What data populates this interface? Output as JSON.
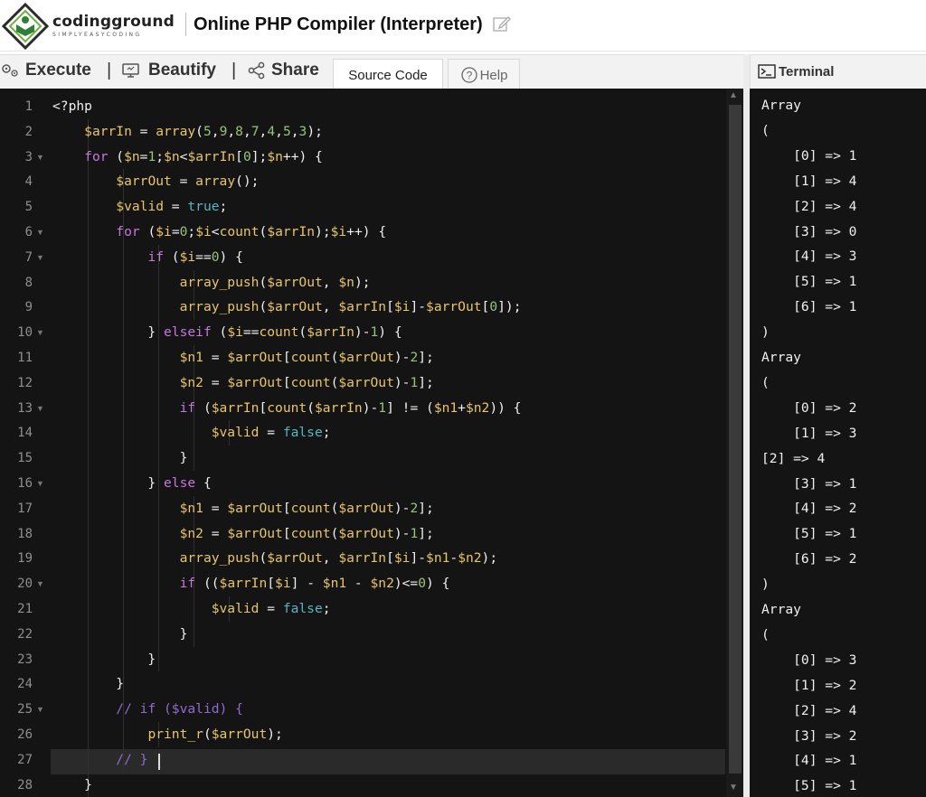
{
  "header": {
    "brand": "codingground",
    "tagline": "SIMPLYEASYCODING",
    "title": "Online PHP Compiler (Interpreter)"
  },
  "toolbar": {
    "execute": "Execute",
    "beautify": "Beautify",
    "share": "Share",
    "separator": "|",
    "tabs": [
      "Source Code",
      "Help"
    ]
  },
  "terminal": {
    "title": "Terminal",
    "lines": [
      "Array",
      "(",
      "    [0] => 1",
      "    [1] => 4",
      "    [2] => 4",
      "    [3] => 0",
      "    [4] => 3",
      "    [5] => 1",
      "    [6] => 1",
      ")",
      "Array",
      "(",
      "    [0] => 2",
      "    [1] => 3",
      "[2] => 4",
      "    [3] => 1",
      "    [4] => 2",
      "    [5] => 1",
      "    [6] => 2",
      ")",
      "Array",
      "(",
      "    [0] => 3",
      "    [1] => 2",
      "    [2] => 4",
      "    [3] => 2",
      "    [4] => 1",
      "    [5] => 1"
    ]
  },
  "editor": {
    "active_line": 27,
    "fold_lines": [
      3,
      6,
      7,
      10,
      13,
      16,
      20,
      25
    ],
    "lines": [
      [
        [
          "pl",
          "<?php"
        ]
      ],
      [
        [
          "pl",
          "    "
        ],
        [
          "var",
          "$arrIn"
        ],
        [
          "pl",
          " = "
        ],
        [
          "fn",
          "array"
        ],
        [
          "pl",
          "("
        ],
        [
          "num",
          "5"
        ],
        [
          "pl",
          ","
        ],
        [
          "num",
          "9"
        ],
        [
          "pl",
          ","
        ],
        [
          "num",
          "8"
        ],
        [
          "pl",
          ","
        ],
        [
          "num",
          "7"
        ],
        [
          "pl",
          ","
        ],
        [
          "num",
          "4"
        ],
        [
          "pl",
          ","
        ],
        [
          "num",
          "5"
        ],
        [
          "pl",
          ","
        ],
        [
          "num",
          "3"
        ],
        [
          "pl",
          ");"
        ]
      ],
      [
        [
          "pl",
          "    "
        ],
        [
          "kw",
          "for"
        ],
        [
          "pl",
          " ("
        ],
        [
          "var",
          "$n"
        ],
        [
          "pl",
          "="
        ],
        [
          "num",
          "1"
        ],
        [
          "pl",
          ";"
        ],
        [
          "var",
          "$n"
        ],
        [
          "pl",
          "<"
        ],
        [
          "var",
          "$arrIn"
        ],
        [
          "pl",
          "["
        ],
        [
          "num",
          "0"
        ],
        [
          "pl",
          "];"
        ],
        [
          "var",
          "$n"
        ],
        [
          "pl",
          "++) {"
        ]
      ],
      [
        [
          "pl",
          "        "
        ],
        [
          "var",
          "$arrOut"
        ],
        [
          "pl",
          " = "
        ],
        [
          "fn",
          "array"
        ],
        [
          "pl",
          "();"
        ]
      ],
      [
        [
          "pl",
          "        "
        ],
        [
          "var",
          "$valid"
        ],
        [
          "pl",
          " = "
        ],
        [
          "bool",
          "true"
        ],
        [
          "pl",
          ";"
        ]
      ],
      [
        [
          "pl",
          "        "
        ],
        [
          "kw",
          "for"
        ],
        [
          "pl",
          " ("
        ],
        [
          "var",
          "$i"
        ],
        [
          "pl",
          "="
        ],
        [
          "num",
          "0"
        ],
        [
          "pl",
          ";"
        ],
        [
          "var",
          "$i"
        ],
        [
          "pl",
          "<"
        ],
        [
          "fn",
          "count"
        ],
        [
          "pl",
          "("
        ],
        [
          "var",
          "$arrIn"
        ],
        [
          "pl",
          ");"
        ],
        [
          "var",
          "$i"
        ],
        [
          "pl",
          "++) {"
        ]
      ],
      [
        [
          "pl",
          "            "
        ],
        [
          "kw",
          "if"
        ],
        [
          "pl",
          " ("
        ],
        [
          "var",
          "$i"
        ],
        [
          "pl",
          "=="
        ],
        [
          "num",
          "0"
        ],
        [
          "pl",
          ") {"
        ]
      ],
      [
        [
          "pl",
          "                "
        ],
        [
          "fn",
          "array_push"
        ],
        [
          "pl",
          "("
        ],
        [
          "var",
          "$arrOut"
        ],
        [
          "pl",
          ", "
        ],
        [
          "var",
          "$n"
        ],
        [
          "pl",
          ");"
        ]
      ],
      [
        [
          "pl",
          "                "
        ],
        [
          "fn",
          "array_push"
        ],
        [
          "pl",
          "("
        ],
        [
          "var",
          "$arrOut"
        ],
        [
          "pl",
          ", "
        ],
        [
          "var",
          "$arrIn"
        ],
        [
          "pl",
          "["
        ],
        [
          "var",
          "$i"
        ],
        [
          "pl",
          "]-"
        ],
        [
          "var",
          "$arrOut"
        ],
        [
          "pl",
          "["
        ],
        [
          "num",
          "0"
        ],
        [
          "pl",
          "]);"
        ]
      ],
      [
        [
          "pl",
          "            } "
        ],
        [
          "kw",
          "elseif"
        ],
        [
          "pl",
          " ("
        ],
        [
          "var",
          "$i"
        ],
        [
          "pl",
          "=="
        ],
        [
          "fn",
          "count"
        ],
        [
          "pl",
          "("
        ],
        [
          "var",
          "$arrIn"
        ],
        [
          "pl",
          ")-"
        ],
        [
          "num",
          "1"
        ],
        [
          "pl",
          ") {"
        ]
      ],
      [
        [
          "pl",
          "                "
        ],
        [
          "var",
          "$n1"
        ],
        [
          "pl",
          " = "
        ],
        [
          "var",
          "$arrOut"
        ],
        [
          "pl",
          "["
        ],
        [
          "fn",
          "count"
        ],
        [
          "pl",
          "("
        ],
        [
          "var",
          "$arrOut"
        ],
        [
          "pl",
          ")-"
        ],
        [
          "num",
          "2"
        ],
        [
          "pl",
          "];"
        ]
      ],
      [
        [
          "pl",
          "                "
        ],
        [
          "var",
          "$n2"
        ],
        [
          "pl",
          " = "
        ],
        [
          "var",
          "$arrOut"
        ],
        [
          "pl",
          "["
        ],
        [
          "fn",
          "count"
        ],
        [
          "pl",
          "("
        ],
        [
          "var",
          "$arrOut"
        ],
        [
          "pl",
          ")-"
        ],
        [
          "num",
          "1"
        ],
        [
          "pl",
          "];"
        ]
      ],
      [
        [
          "pl",
          "                "
        ],
        [
          "kw",
          "if"
        ],
        [
          "pl",
          " ("
        ],
        [
          "var",
          "$arrIn"
        ],
        [
          "pl",
          "["
        ],
        [
          "fn",
          "count"
        ],
        [
          "pl",
          "("
        ],
        [
          "var",
          "$arrIn"
        ],
        [
          "pl",
          ")-"
        ],
        [
          "num",
          "1"
        ],
        [
          "pl",
          "] != ("
        ],
        [
          "var",
          "$n1"
        ],
        [
          "pl",
          "+"
        ],
        [
          "var",
          "$n2"
        ],
        [
          "pl",
          ")) {"
        ]
      ],
      [
        [
          "pl",
          "                    "
        ],
        [
          "var",
          "$valid"
        ],
        [
          "pl",
          " = "
        ],
        [
          "bool",
          "false"
        ],
        [
          "pl",
          ";"
        ]
      ],
      [
        [
          "pl",
          "                }"
        ]
      ],
      [
        [
          "pl",
          "            } "
        ],
        [
          "kw",
          "else"
        ],
        [
          "pl",
          " {"
        ]
      ],
      [
        [
          "pl",
          "                "
        ],
        [
          "var",
          "$n1"
        ],
        [
          "pl",
          " = "
        ],
        [
          "var",
          "$arrOut"
        ],
        [
          "pl",
          "["
        ],
        [
          "fn",
          "count"
        ],
        [
          "pl",
          "("
        ],
        [
          "var",
          "$arrOut"
        ],
        [
          "pl",
          ")-"
        ],
        [
          "num",
          "2"
        ],
        [
          "pl",
          "];"
        ]
      ],
      [
        [
          "pl",
          "                "
        ],
        [
          "var",
          "$n2"
        ],
        [
          "pl",
          " = "
        ],
        [
          "var",
          "$arrOut"
        ],
        [
          "pl",
          "["
        ],
        [
          "fn",
          "count"
        ],
        [
          "pl",
          "("
        ],
        [
          "var",
          "$arrOut"
        ],
        [
          "pl",
          ")-"
        ],
        [
          "num",
          "1"
        ],
        [
          "pl",
          "];"
        ]
      ],
      [
        [
          "pl",
          "                "
        ],
        [
          "fn",
          "array_push"
        ],
        [
          "pl",
          "("
        ],
        [
          "var",
          "$arrOut"
        ],
        [
          "pl",
          ", "
        ],
        [
          "var",
          "$arrIn"
        ],
        [
          "pl",
          "["
        ],
        [
          "var",
          "$i"
        ],
        [
          "pl",
          "]-"
        ],
        [
          "var",
          "$n1"
        ],
        [
          "pl",
          "-"
        ],
        [
          "var",
          "$n2"
        ],
        [
          "pl",
          ");"
        ]
      ],
      [
        [
          "pl",
          "                "
        ],
        [
          "kw",
          "if"
        ],
        [
          "pl",
          " (("
        ],
        [
          "var",
          "$arrIn"
        ],
        [
          "pl",
          "["
        ],
        [
          "var",
          "$i"
        ],
        [
          "pl",
          "] - "
        ],
        [
          "var",
          "$n1"
        ],
        [
          "pl",
          " - "
        ],
        [
          "var",
          "$n2"
        ],
        [
          "pl",
          ")<="
        ],
        [
          "num",
          "0"
        ],
        [
          "pl",
          ") {"
        ]
      ],
      [
        [
          "pl",
          "                    "
        ],
        [
          "var",
          "$valid"
        ],
        [
          "pl",
          " = "
        ],
        [
          "bool",
          "false"
        ],
        [
          "pl",
          ";"
        ]
      ],
      [
        [
          "pl",
          "                }"
        ]
      ],
      [
        [
          "pl",
          "            }"
        ]
      ],
      [
        [
          "pl",
          "        }"
        ]
      ],
      [
        [
          "pl",
          "        "
        ],
        [
          "cm",
          "// if ($valid) {"
        ]
      ],
      [
        [
          "pl",
          "            "
        ],
        [
          "fn",
          "print_r"
        ],
        [
          "pl",
          "("
        ],
        [
          "var",
          "$arrOut"
        ],
        [
          "pl",
          ");"
        ]
      ],
      [
        [
          "pl",
          "        "
        ],
        [
          "cm",
          "// }"
        ]
      ],
      [
        [
          "pl",
          "    }"
        ]
      ]
    ]
  }
}
